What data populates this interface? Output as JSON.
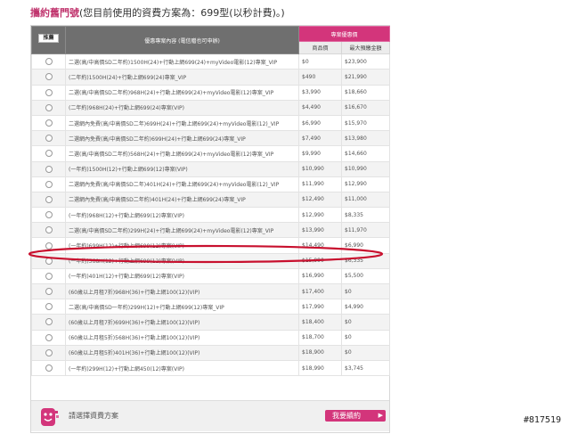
{
  "header": {
    "label": "攜約舊門號",
    "text": "(您目前使用的資費方案為：699型(以秒計費)。)"
  },
  "table": {
    "col_recommend_badge": "推薦",
    "col_content": "優惠專案內容 (電信贈也可申辦)",
    "col_group": "專案優惠價",
    "col_price": "商品價",
    "col_max": "最大預繳金額",
    "rows": [
      {
        "content": "二選(高/中高價SD二年約)1500H(24)+行動上網699(24)+myVideo電影(12)專案_VIP",
        "price": "$0",
        "max": "$23,900"
      },
      {
        "content": "(二年約)1500H(24)+行動上網699(24)專案_VIP",
        "price": "$490",
        "max": "$21,990"
      },
      {
        "content": "二選(高/中高價SD二年約)968H(24)+行動上網699(24)+myVideo電影(12)專案_VIP",
        "price": "$3,990",
        "max": "$18,660"
      },
      {
        "content": "(二年約)968H(24)+行動上網699(24)專案(VIP)",
        "price": "$4,490",
        "max": "$16,670"
      },
      {
        "content": "二選網內免費(高/中高價SD二年)699H(24)+行動上網699(24)+myVideo電影(12)_VIP",
        "price": "$6,990",
        "max": "$15,970"
      },
      {
        "content": "二選網內免費(高/中高價SD二年約)699H(24)+行動上網699(24)專案_VIP",
        "price": "$7,490",
        "max": "$13,980"
      },
      {
        "content": "二選(高/中高價SD二年約)568H(24)+行動上網699(24)+myVideo電影(12)專案_VIP",
        "price": "$9,990",
        "max": "$14,660"
      },
      {
        "content": "(一年約)1500H(12)+行動上網699(12)專案(VIP)",
        "price": "$10,990",
        "max": "$10,990"
      },
      {
        "content": "二選網內免費(高/中高價SD二年)401H(24)+行動上網699(24)+myVideo電影(12)_VIP",
        "price": "$11,990",
        "max": "$12,990"
      },
      {
        "content": "二選網內免費(高/中高價SD二年約)401H(24)+行動上網699(24)專案_VIP",
        "price": "$12,490",
        "max": "$11,000"
      },
      {
        "content": "(一年約)968H(12)+行動上網699(12)專案(VIP)",
        "price": "$12,990",
        "max": "$8,335"
      },
      {
        "content": "二選(高/中高價SD二年約)299H(24)+行動上網699(24)+myVideo電影(12)專案_VIP",
        "price": "$13,990",
        "max": "$11,970"
      },
      {
        "content": "(一年約)699H(12)+行動上網699(12)專案(VIP)",
        "price": "$14,490",
        "max": "$6,990"
      },
      {
        "content": "(一年約)568H(12)+行動上網699(12)專案(VIP)",
        "price": "$15,990",
        "max": "$6,335"
      },
      {
        "content": "(一年約)401H(12)+行動上網699(12)專案(VIP)",
        "price": "$16,990",
        "max": "$5,500"
      },
      {
        "content": "(60歲以上月租7折)968H(36)+行動上網100(12)(VIP)",
        "price": "$17,400",
        "max": "$0"
      },
      {
        "content": "二選(高/中高價SD一年約)299H(12)+行動上網699(12)專案_VIP",
        "price": "$17,990",
        "max": "$4,990"
      },
      {
        "content": "(60歲以上月租7折)699H(36)+行動上網100(12)(VIP)",
        "price": "$18,400",
        "max": "$0"
      },
      {
        "content": "(60歲以上月租5折)568H(36)+行動上網100(12)(VIP)",
        "price": "$18,700",
        "max": "$0"
      },
      {
        "content": "(60歲以上月租5折)401H(36)+行動上網100(12)(VIP)",
        "price": "$18,900",
        "max": "$0"
      },
      {
        "content": "(一年約)299H(12)+行動上網450(12)專案(VIP)",
        "price": "$18,990",
        "max": "$3,745"
      }
    ]
  },
  "footer": {
    "prompt": "請選擇資費方案",
    "sign_button": "我要續約",
    "sign_arrow": "▶"
  },
  "watermark": "#817519",
  "colors": {
    "accent_pink": "#d3357b",
    "header_gray": "#6f6f6f",
    "annotation_red": "#c8102e"
  },
  "annotation": {
    "highlighted_row_index": 12
  }
}
